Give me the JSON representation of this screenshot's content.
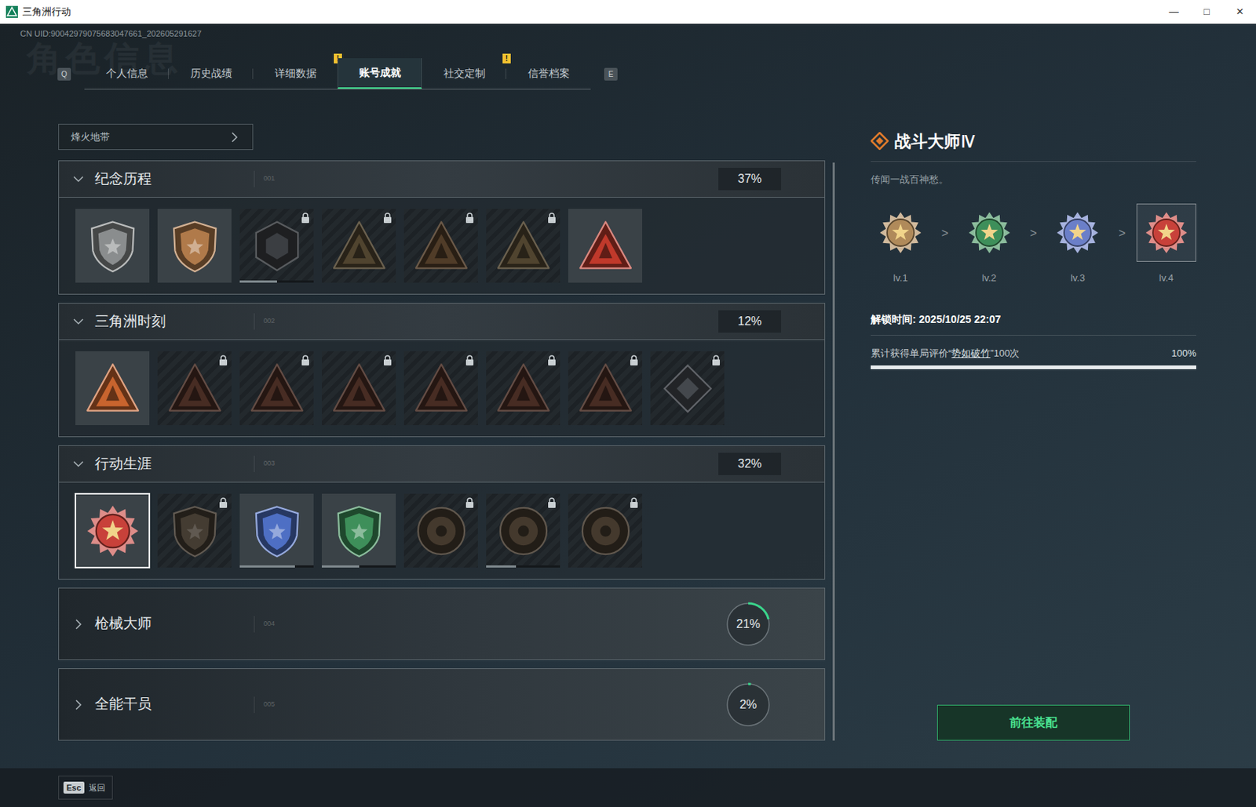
{
  "window": {
    "title": "三角洲行动",
    "controls": [
      "—",
      "□",
      "✕"
    ]
  },
  "uid": "CN UID:90042979075683047661_202605291627",
  "watermark": "角色信息",
  "tabs": {
    "prev_key": "Q",
    "next_key": "E",
    "items": [
      {
        "label": "个人信息",
        "selected": false
      },
      {
        "label": "历史战绩",
        "selected": false
      },
      {
        "label": "详细数据",
        "selected": false,
        "badge": "!"
      },
      {
        "label": "账号成就",
        "selected": true
      },
      {
        "label": "社交定制",
        "selected": false,
        "badge": "!"
      },
      {
        "label": "信誉档案",
        "selected": false
      }
    ]
  },
  "mode_select": {
    "value": "烽火地带",
    "expanded": false
  },
  "sections": [
    {
      "title": "纪念历程",
      "code": "001",
      "expanded": true,
      "reading": "37%",
      "achievements": [
        {
          "kind": "shield",
          "color": "#8a8d8e",
          "locked": false,
          "selected": false
        },
        {
          "kind": "shield",
          "color": "#b07a4a",
          "locked": false,
          "selected": false
        },
        {
          "kind": "hex",
          "color": "#4e5358",
          "locked": true,
          "selected": false,
          "level": 0.5
        },
        {
          "kind": "triangle",
          "color": "#6b5a3e",
          "locked": true,
          "selected": false
        },
        {
          "kind": "triangle",
          "color": "#6b5035",
          "locked": true,
          "selected": false
        },
        {
          "kind": "triangle",
          "color": "#6b5a3e",
          "locked": true,
          "selected": false
        },
        {
          "kind": "triangle",
          "color": "#c0392b",
          "locked": false,
          "selected": false
        }
      ]
    },
    {
      "title": "三角洲时刻",
      "code": "002",
      "expanded": true,
      "reading": "12%",
      "achievements": [
        {
          "kind": "triangle",
          "color": "#c8642e",
          "locked": false,
          "selected": false
        },
        {
          "kind": "triangle",
          "color": "#5e3b2e",
          "locked": true,
          "selected": false
        },
        {
          "kind": "triangle",
          "color": "#5e3b2e",
          "locked": true,
          "selected": false
        },
        {
          "kind": "triangle",
          "color": "#5e3b2e",
          "locked": true,
          "selected": false
        },
        {
          "kind": "triangle",
          "color": "#5e3b2e",
          "locked": true,
          "selected": false
        },
        {
          "kind": "triangle",
          "color": "#5e3b2e",
          "locked": true,
          "selected": false
        },
        {
          "kind": "triangle",
          "color": "#5e3b2e",
          "locked": true,
          "selected": false
        },
        {
          "kind": "diamond",
          "color": "#5a6066",
          "locked": true,
          "selected": false
        }
      ]
    },
    {
      "title": "行动生涯",
      "code": "003",
      "expanded": true,
      "reading": "32%",
      "achievements": [
        {
          "kind": "medal",
          "color": "#c8413a",
          "locked": false,
          "selected": true
        },
        {
          "kind": "shield",
          "color": "#5b5042",
          "locked": true,
          "selected": false
        },
        {
          "kind": "shield",
          "color": "#4e6fc4",
          "locked": false,
          "selected": false,
          "level": 0.75
        },
        {
          "kind": "shield",
          "color": "#3e8f5a",
          "locked": false,
          "selected": false,
          "level": 0.5
        },
        {
          "kind": "round",
          "color": "#5a4c3c",
          "locked": true,
          "selected": false
        },
        {
          "kind": "round",
          "color": "#5a4c3c",
          "locked": true,
          "selected": false,
          "level": 0.4
        },
        {
          "kind": "round",
          "color": "#5a4c3c",
          "locked": true,
          "selected": false
        }
      ]
    },
    {
      "title": "枪械大师",
      "code": "004",
      "expanded": false,
      "reading": "21%",
      "level": 0.21
    },
    {
      "title": "全能干员",
      "code": "005",
      "expanded": false,
      "reading": "2%",
      "level": 0.02
    }
  ],
  "detail": {
    "title": "战斗大师Ⅳ",
    "description": "传闻一战百神愁。",
    "separator": ">",
    "levels": [
      {
        "label": "lv.1",
        "selected": false,
        "color": "#b08a5a"
      },
      {
        "label": "lv.2",
        "selected": false,
        "color": "#3e8f5a"
      },
      {
        "label": "lv.3",
        "selected": false,
        "color": "#6b7fc8"
      },
      {
        "label": "lv.4",
        "selected": true,
        "color": "#c8413a"
      }
    ],
    "unlock_time": "解锁时间: 2025/10/25 22:07",
    "progress": {
      "prefix": "累计获得单局评价“",
      "link": "势如破竹",
      "suffix": "”100次",
      "reading": "100%",
      "level": 1
    },
    "button": "前往装配"
  },
  "footer": {
    "key": "Esc",
    "label": "返回"
  }
}
